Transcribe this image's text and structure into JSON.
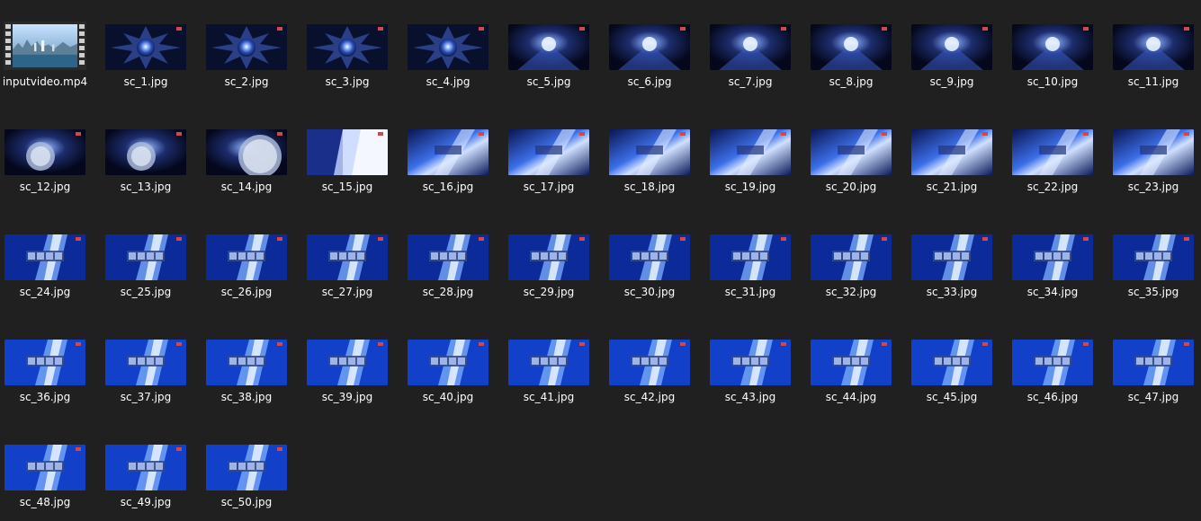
{
  "window": {
    "background": "#202020",
    "text_color": "#ffffff"
  },
  "files": [
    {
      "name": "inputvideo.mp4",
      "type": "video",
      "icon": "vlc-video-file-icon",
      "style": "city"
    },
    {
      "name": "sc_1.jpg",
      "type": "image",
      "style": "burst"
    },
    {
      "name": "sc_2.jpg",
      "type": "image",
      "style": "burst"
    },
    {
      "name": "sc_3.jpg",
      "type": "image",
      "style": "burst"
    },
    {
      "name": "sc_4.jpg",
      "type": "image",
      "style": "burst"
    },
    {
      "name": "sc_5.jpg",
      "type": "image",
      "style": "glow"
    },
    {
      "name": "sc_6.jpg",
      "type": "image",
      "style": "glow"
    },
    {
      "name": "sc_7.jpg",
      "type": "image",
      "style": "glow"
    },
    {
      "name": "sc_8.jpg",
      "type": "image",
      "style": "glow"
    },
    {
      "name": "sc_9.jpg",
      "type": "image",
      "style": "glow"
    },
    {
      "name": "sc_10.jpg",
      "type": "image",
      "style": "glow"
    },
    {
      "name": "sc_11.jpg",
      "type": "image",
      "style": "glow"
    },
    {
      "name": "sc_12.jpg",
      "type": "image",
      "style": "sphere"
    },
    {
      "name": "sc_13.jpg",
      "type": "image",
      "style": "sphere"
    },
    {
      "name": "sc_14.jpg",
      "type": "image",
      "style": "sphere-bright"
    },
    {
      "name": "sc_15.jpg",
      "type": "image",
      "style": "white"
    },
    {
      "name": "sc_16.jpg",
      "type": "image",
      "style": "rays"
    },
    {
      "name": "sc_17.jpg",
      "type": "image",
      "style": "rays"
    },
    {
      "name": "sc_18.jpg",
      "type": "image",
      "style": "rays"
    },
    {
      "name": "sc_19.jpg",
      "type": "image",
      "style": "rays"
    },
    {
      "name": "sc_20.jpg",
      "type": "image",
      "style": "rays"
    },
    {
      "name": "sc_21.jpg",
      "type": "image",
      "style": "rays"
    },
    {
      "name": "sc_22.jpg",
      "type": "image",
      "style": "rays"
    },
    {
      "name": "sc_23.jpg",
      "type": "image",
      "style": "rays"
    },
    {
      "name": "sc_24.jpg",
      "type": "image",
      "style": "title"
    },
    {
      "name": "sc_25.jpg",
      "type": "image",
      "style": "title"
    },
    {
      "name": "sc_26.jpg",
      "type": "image",
      "style": "title"
    },
    {
      "name": "sc_27.jpg",
      "type": "image",
      "style": "title"
    },
    {
      "name": "sc_28.jpg",
      "type": "image",
      "style": "title"
    },
    {
      "name": "sc_29.jpg",
      "type": "image",
      "style": "title"
    },
    {
      "name": "sc_30.jpg",
      "type": "image",
      "style": "title"
    },
    {
      "name": "sc_31.jpg",
      "type": "image",
      "style": "title"
    },
    {
      "name": "sc_32.jpg",
      "type": "image",
      "style": "title"
    },
    {
      "name": "sc_33.jpg",
      "type": "image",
      "style": "title"
    },
    {
      "name": "sc_34.jpg",
      "type": "image",
      "style": "title"
    },
    {
      "name": "sc_35.jpg",
      "type": "image",
      "style": "title"
    },
    {
      "name": "sc_36.jpg",
      "type": "image",
      "style": "title-bright"
    },
    {
      "name": "sc_37.jpg",
      "type": "image",
      "style": "title-bright"
    },
    {
      "name": "sc_38.jpg",
      "type": "image",
      "style": "title-bright"
    },
    {
      "name": "sc_39.jpg",
      "type": "image",
      "style": "title-bright"
    },
    {
      "name": "sc_40.jpg",
      "type": "image",
      "style": "title-bright"
    },
    {
      "name": "sc_41.jpg",
      "type": "image",
      "style": "title-bright"
    },
    {
      "name": "sc_42.jpg",
      "type": "image",
      "style": "title-bright"
    },
    {
      "name": "sc_43.jpg",
      "type": "image",
      "style": "title-bright"
    },
    {
      "name": "sc_44.jpg",
      "type": "image",
      "style": "title-bright"
    },
    {
      "name": "sc_45.jpg",
      "type": "image",
      "style": "title-bright"
    },
    {
      "name": "sc_46.jpg",
      "type": "image",
      "style": "title-bright"
    },
    {
      "name": "sc_47.jpg",
      "type": "image",
      "style": "title-bright"
    },
    {
      "name": "sc_48.jpg",
      "type": "image",
      "style": "title-bright"
    },
    {
      "name": "sc_49.jpg",
      "type": "image",
      "style": "title-bright"
    },
    {
      "name": "sc_50.jpg",
      "type": "image",
      "style": "title-bright"
    }
  ]
}
